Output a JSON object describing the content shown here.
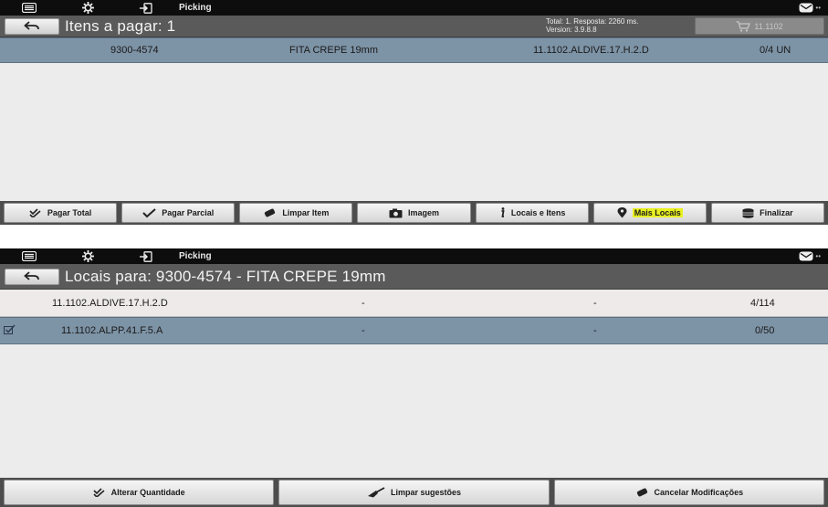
{
  "colors": {
    "accent_selected_row": "#7d93a6",
    "header": "#5a5a5a",
    "topbar": "#0d0d0d",
    "highlight": "#e8f020"
  },
  "screen1": {
    "topbar": {
      "title": "Picking",
      "right_dots": "••",
      "icons": [
        "list-icon",
        "gear-icon",
        "login-icon",
        "mail-icon"
      ]
    },
    "header": {
      "title": "Itens a pagar: 1",
      "info_line1": "Total: 1. Resposta: 2260 ms.",
      "info_line2": "Version: 3.9.8.8",
      "cart_label": "11.1102"
    },
    "rows": [
      {
        "code": "9300-4574",
        "description": "FITA CREPE 19mm",
        "location": "11.1102.ALDIVE.17.H.2.D",
        "qty": "0/4 UN"
      }
    ],
    "footer": {
      "pagar_total": "Pagar Total",
      "pagar_parcial": "Pagar Parcial",
      "limpar_item": "Limpar Item",
      "imagem": "Imagem",
      "locais_itens": "Locais e Itens",
      "mais_locais": "Mais Locais",
      "finalizar": "Finalizar"
    }
  },
  "screen2": {
    "topbar": {
      "title": "Picking",
      "right_dots": "••"
    },
    "header": {
      "title": "Locais para: 9300-4574 - FITA CREPE 19mm"
    },
    "rows": [
      {
        "location": "11.1102.ALDIVE.17.H.2.D",
        "col2": "-",
        "col3": "-",
        "qty": "4/114"
      },
      {
        "location": "11.1102.ALPP.41.F.5.A",
        "col2": "-",
        "col3": "-",
        "qty": "0/50"
      }
    ],
    "footer": {
      "alterar_quantidade": "Alterar Quantidade",
      "limpar_sugestoes": "Limpar sugestões",
      "cancelar_modificacoes": "Cancelar Modificações"
    }
  }
}
